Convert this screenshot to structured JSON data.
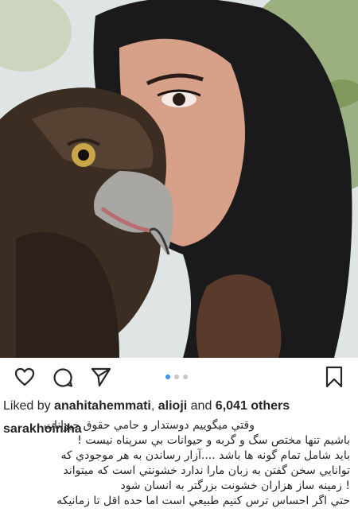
{
  "post": {
    "liked_by_prefix": "Liked by ",
    "liked_user_1": "anahitahemmati",
    "separator": ", ",
    "liked_user_2": "alioji",
    "and_text": " and ",
    "others_count": "6,041 others",
    "caption_author": "sarakhoiniha",
    "caption_lines": [
      "وقتي ميگوييم دوستدار و حامي حقوق حيوانات",
      "باشيم تنها مختص سگ و گربه و حيوانات بي سرپناه نيست !",
      "بايد شامل تمام گونه ها باشد ....آزار رساندن به هر موجودي که",
      "توانايي سخن گفتن به زبان مارا ندارد خشونتي است که ميتواند",
      "! زمينه ساز هزاران خشونت بزرگتر به انسان شود",
      "حتي اگر احساس ترس کنيم طبيعي است اما حده اقل  تا زمانيکه"
    ]
  },
  "carousel": {
    "total": 3,
    "active": 1
  },
  "icons": {
    "like": "heart-icon",
    "comment": "comment-icon",
    "share": "send-icon",
    "save": "bookmark-icon"
  },
  "colors": {
    "accent": "#3897f0",
    "text": "#262626",
    "dot_inactive": "#c7c7c7"
  }
}
